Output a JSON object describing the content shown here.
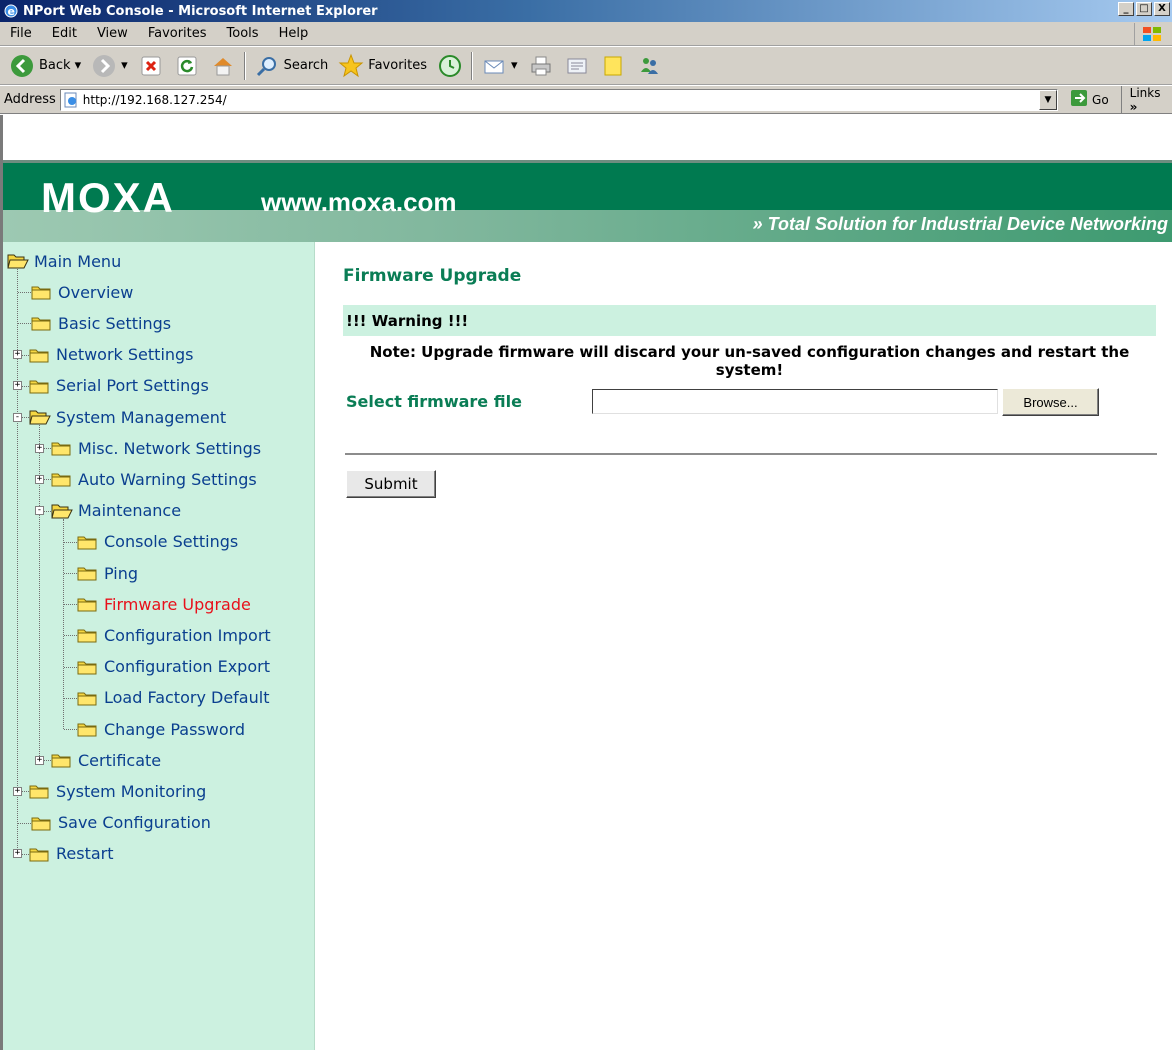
{
  "window": {
    "title": "NPort Web Console - Microsoft Internet Explorer",
    "minimize": "_",
    "maximize": "□",
    "close": "X"
  },
  "menubar": {
    "items": [
      "File",
      "Edit",
      "View",
      "Favorites",
      "Tools",
      "Help"
    ]
  },
  "toolbar": {
    "back": "Back",
    "search": "Search",
    "favorites": "Favorites"
  },
  "addressbar": {
    "label": "Address",
    "url": "http://192.168.127.254/",
    "go": "Go",
    "links": "Links"
  },
  "banner": {
    "logo": "MOXA",
    "url": "www.moxa.com",
    "tagline": "Total Solution for Industrial Device Networking"
  },
  "sidebar": {
    "items": [
      {
        "label": "Main Menu",
        "level": 0,
        "expander": "",
        "open": true
      },
      {
        "label": "Overview",
        "level": 1,
        "expander": ""
      },
      {
        "label": "Basic Settings",
        "level": 1,
        "expander": ""
      },
      {
        "label": "Network Settings",
        "level": 1,
        "expander": "+"
      },
      {
        "label": "Serial Port Settings",
        "level": 1,
        "expander": "+"
      },
      {
        "label": "System Management",
        "level": 1,
        "expander": "-",
        "open": true
      },
      {
        "label": "Misc. Network Settings",
        "level": 2,
        "expander": "+"
      },
      {
        "label": "Auto Warning Settings",
        "level": 2,
        "expander": "+"
      },
      {
        "label": "Maintenance",
        "level": 2,
        "expander": "-",
        "open": true
      },
      {
        "label": "Console Settings",
        "level": 3,
        "expander": ""
      },
      {
        "label": "Ping",
        "level": 3,
        "expander": ""
      },
      {
        "label": "Firmware Upgrade",
        "level": 3,
        "expander": "",
        "active": true
      },
      {
        "label": "Configuration Import",
        "level": 3,
        "expander": ""
      },
      {
        "label": "Configuration Export",
        "level": 3,
        "expander": ""
      },
      {
        "label": "Load Factory Default",
        "level": 3,
        "expander": ""
      },
      {
        "label": "Change Password",
        "level": 3,
        "expander": ""
      },
      {
        "label": "Certificate",
        "level": 2,
        "expander": "+"
      },
      {
        "label": "System Monitoring",
        "level": 1,
        "expander": "+"
      },
      {
        "label": "Save Configuration",
        "level": 1,
        "expander": ""
      },
      {
        "label": "Restart",
        "level": 1,
        "expander": "+"
      }
    ]
  },
  "main": {
    "title": "Firmware Upgrade",
    "warning": "!!! Warning !!!",
    "note": "Note: Upgrade firmware will discard your un-saved configuration changes and restart the system!",
    "file_label": "Select firmware file",
    "file_value": "",
    "browse": "Browse...",
    "submit": "Submit"
  },
  "colors": {
    "banner": "#007a50",
    "sidebar_bg": "#ccf1e0",
    "title_green": "#0a7d55",
    "link_blue": "#0a3f8f",
    "active_red": "#e8101a"
  }
}
